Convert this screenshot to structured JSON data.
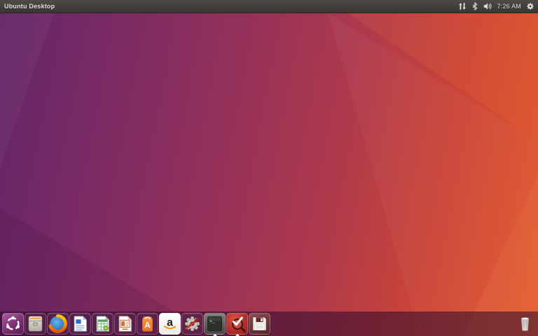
{
  "topbar": {
    "title": "Ubuntu Desktop",
    "clock": "7:26 AM",
    "tray_icons": [
      "network-activity-icon",
      "bluetooth-icon",
      "volume-icon"
    ],
    "session_icon": "session-gear-icon"
  },
  "wallpaper": {
    "gradient_start": "#622569",
    "gradient_mid": "#b03a4b",
    "gradient_end": "#e2582c"
  },
  "launcher": {
    "position": "bottom",
    "background": "rgba(46,9,44,0.55)",
    "items": [
      {
        "name": "dash-home",
        "running": false
      },
      {
        "name": "files",
        "running": false
      },
      {
        "name": "firefox",
        "running": false
      },
      {
        "name": "libreoffice-writer",
        "running": false
      },
      {
        "name": "libreoffice-calc",
        "running": false
      },
      {
        "name": "libreoffice-impress",
        "running": false
      },
      {
        "name": "ubuntu-software",
        "running": false
      },
      {
        "name": "amazon",
        "running": false
      },
      {
        "name": "system-settings",
        "running": false
      },
      {
        "name": "terminal",
        "running": true
      },
      {
        "name": "check-magnifier",
        "running": true
      },
      {
        "name": "floppy-disk",
        "running": false
      }
    ],
    "trash": {
      "name": "trash",
      "running": false
    }
  }
}
